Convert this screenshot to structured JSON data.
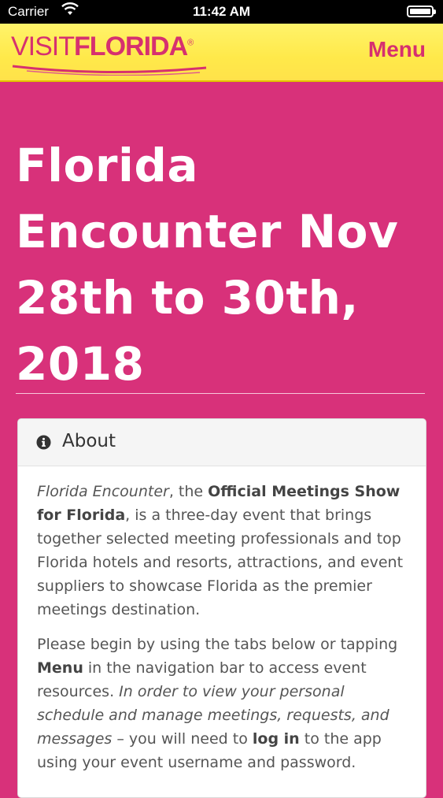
{
  "status_bar": {
    "carrier": "Carrier",
    "time": "11:42 AM",
    "icons": [
      "wifi-icon",
      "battery-icon"
    ]
  },
  "navbar": {
    "logo_visit": "VISIT",
    "logo_florida": "FLORIDA",
    "logo_mark": "®",
    "menu_label": "Menu"
  },
  "hero": {
    "title": "Florida Encounter Nov 28th to 30th, 2018"
  },
  "about": {
    "icon": "info-circle-icon",
    "header": "About",
    "p1": {
      "event_name": "Florida Encounter",
      "t1": ", the ",
      "official": "Official Meetings Show for Florida",
      "t2": ", is a three-day event that brings together selected meeting professionals and top Florida hotels and resorts, attractions, and event suppliers to showcase Florida as the premier meetings destination."
    },
    "p2": {
      "t1": "Please begin by using the tabs below or tapping ",
      "menu": "Menu",
      "t2": " in the navigation bar to access event resources. ",
      "italic": "In order to view your personal schedule and manage meetings, requests, and messages",
      "t3": " – you will need to ",
      "login": "log in",
      "t4": " to the app using your event username and password."
    }
  },
  "colors": {
    "background": "#d8317a",
    "navbar": "#ffe94a",
    "brand": "#d6306f"
  }
}
